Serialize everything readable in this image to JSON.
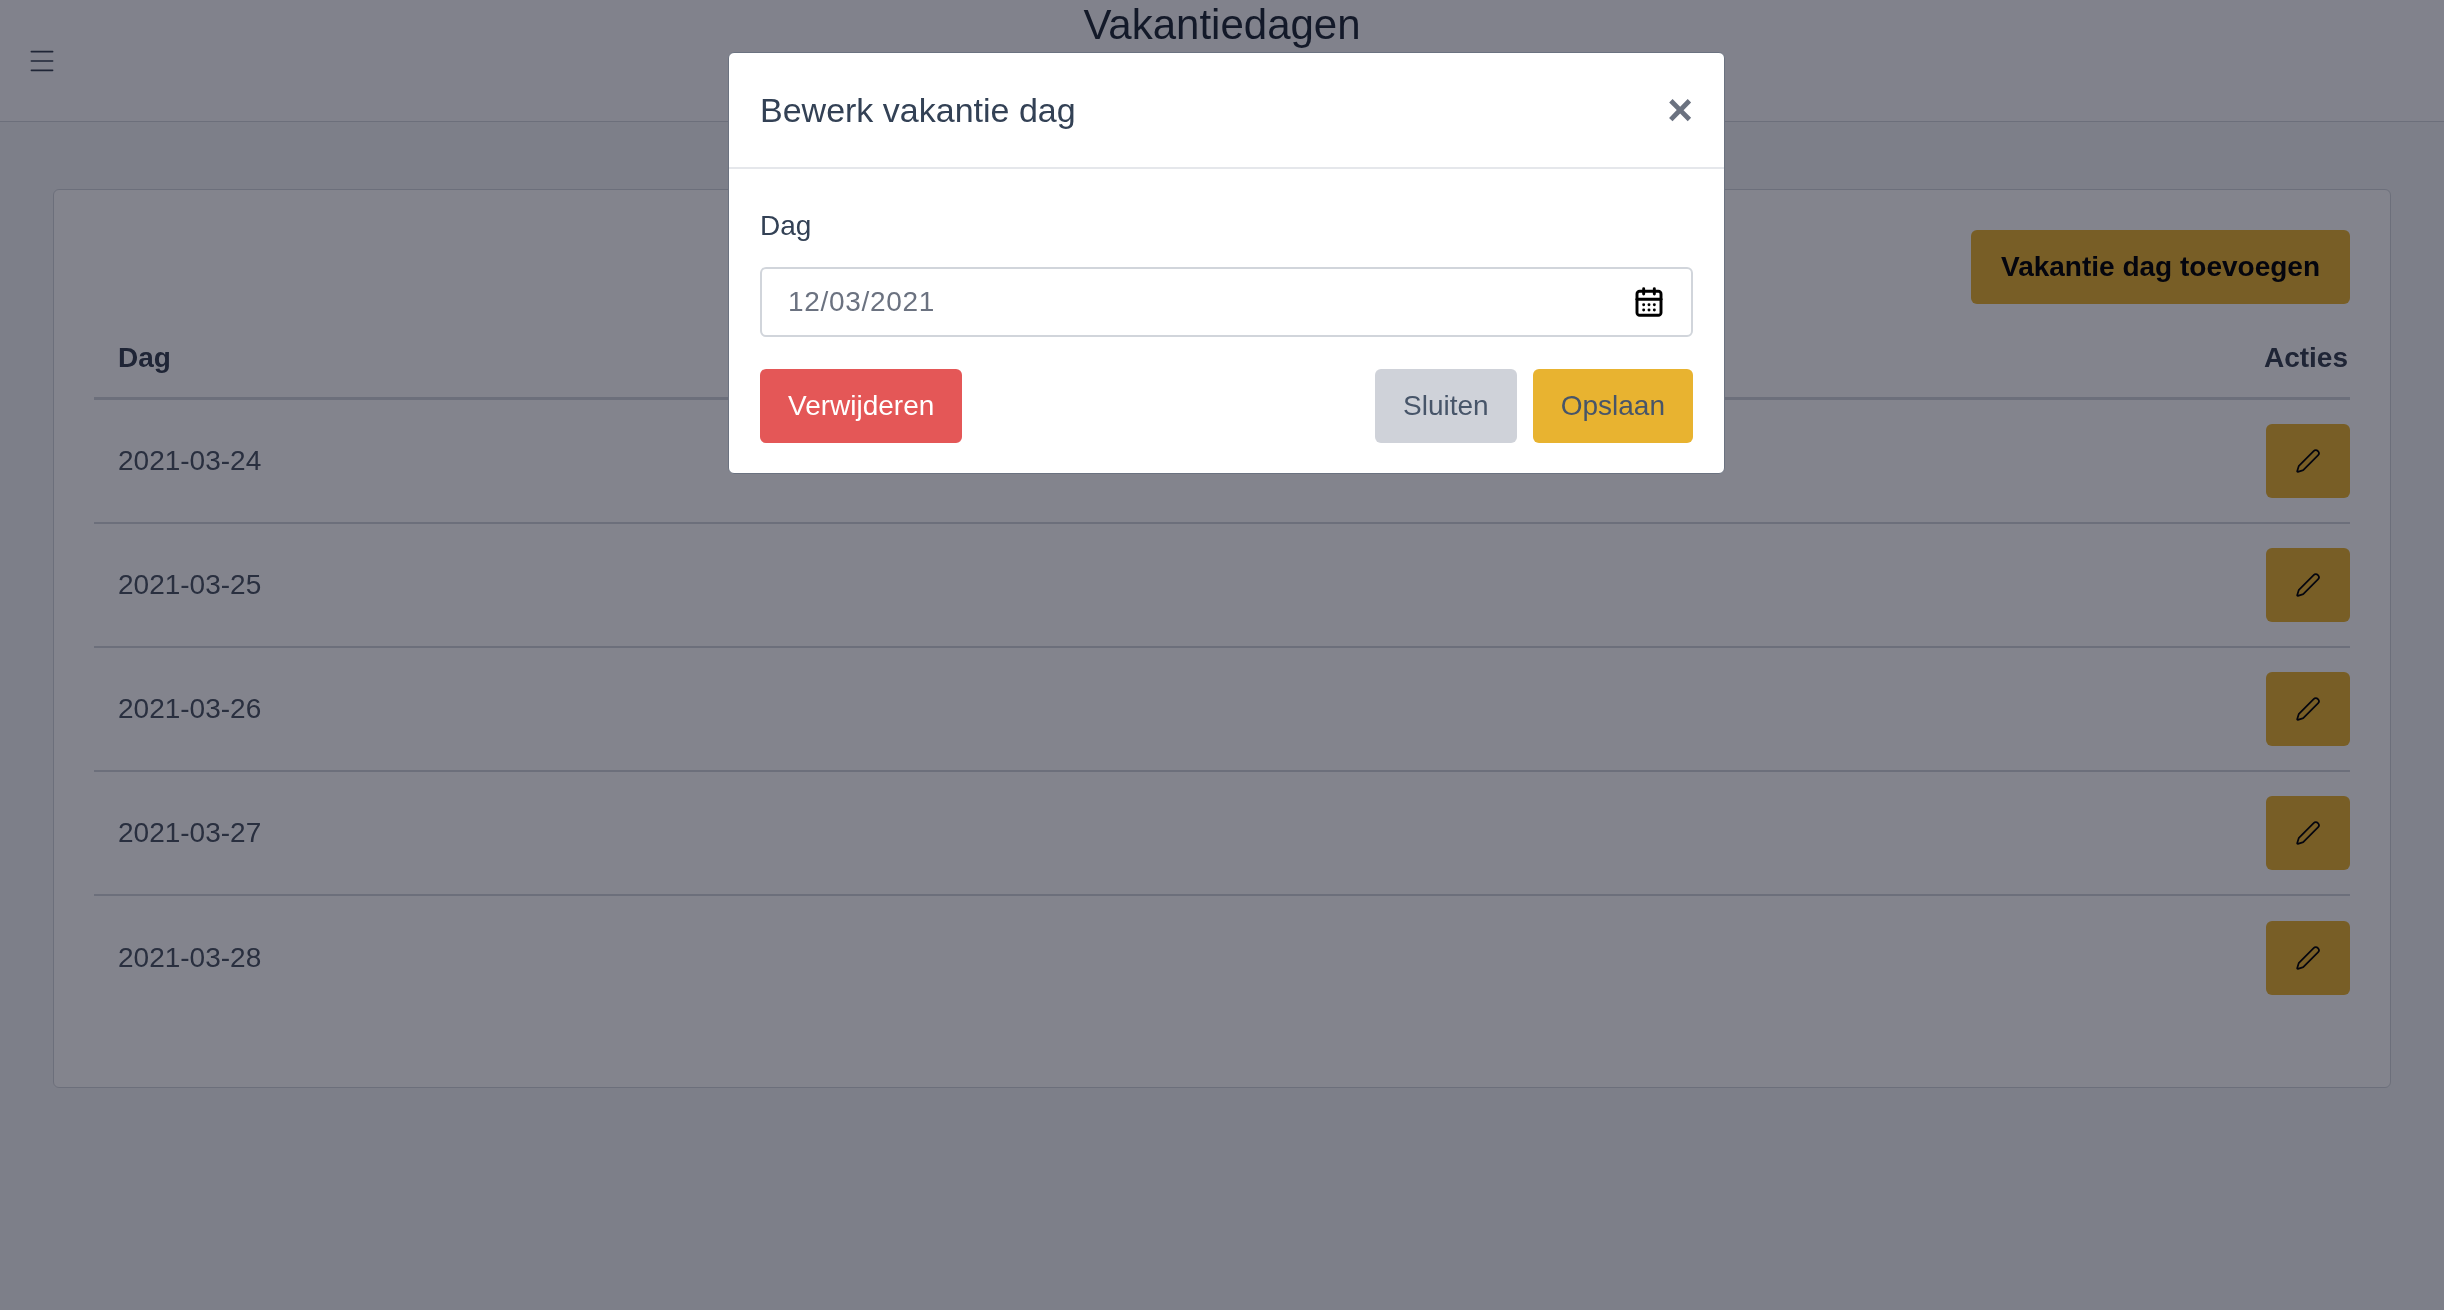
{
  "header": {
    "title": "Vakantiedagen"
  },
  "add_button": "Vakantie dag toevoegen",
  "table": {
    "columns": [
      "Dag",
      "Acties"
    ],
    "rows": [
      {
        "dag": "2021-03-24"
      },
      {
        "dag": "2021-03-25"
      },
      {
        "dag": "2021-03-26"
      },
      {
        "dag": "2021-03-27"
      },
      {
        "dag": "2021-03-28"
      }
    ]
  },
  "modal": {
    "title": "Bewerk vakantie dag",
    "close": "×",
    "field_label": "Dag",
    "field_value": "12/03/2021",
    "buttons": [
      {
        "kind": "danger",
        "label": "Verwijderen"
      },
      {
        "kind": "secondary",
        "label": "Sluiten"
      },
      {
        "kind": "primary",
        "label": "Opslaan"
      }
    ]
  }
}
